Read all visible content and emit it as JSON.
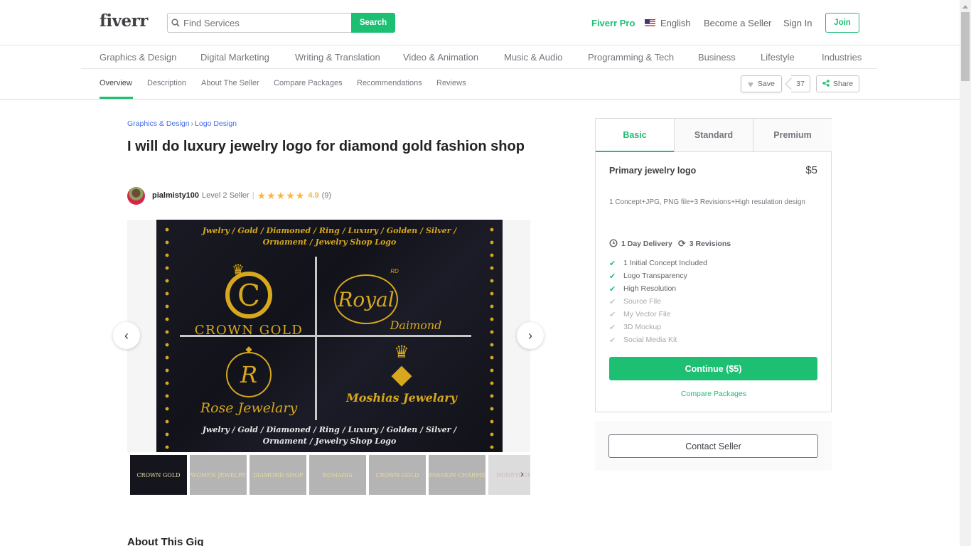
{
  "header": {
    "logo": "fiverr",
    "search": {
      "placeholder": "Find Services",
      "button": "Search"
    },
    "nav": {
      "pro": "Fiverr Pro",
      "language": "English",
      "become_seller": "Become a Seller",
      "sign_in": "Sign In",
      "join": "Join"
    }
  },
  "categories": [
    "Graphics & Design",
    "Digital Marketing",
    "Writing & Translation",
    "Video & Animation",
    "Music & Audio",
    "Programming & Tech",
    "Business",
    "Lifestyle",
    "Industries"
  ],
  "subnav": {
    "tabs": [
      "Overview",
      "Description",
      "About The Seller",
      "Compare Packages",
      "Recommendations",
      "Reviews"
    ],
    "active": "Overview",
    "save_label": "Save",
    "save_count": "37",
    "share_label": "Share"
  },
  "gig": {
    "breadcrumb": [
      "Graphics & Design",
      "Logo Design"
    ],
    "breadcrumb_separator": "›",
    "title": "I will do luxury jewelry logo for diamond gold fashion shop",
    "seller": {
      "username": "pialmisty100",
      "level": "Level 2 Seller",
      "separator": "|",
      "stars": "★★★★★",
      "rating": "4.9",
      "reviews": "(9)"
    },
    "image": {
      "header_line1": "Jwelry / Gold / Diamoned / Ring / Luxury / Golden / Silver /",
      "header_line2": "Ornament / Jewelry Shop Logo",
      "logos": [
        {
          "mark": "C",
          "name": "CROWN GOLD"
        },
        {
          "mark": "Royal",
          "sub": "Daimond",
          "top": "RD"
        },
        {
          "mark": "R",
          "name": "Rose Jewelary"
        },
        {
          "mark": "◆",
          "name": "Moshias Jewelary"
        }
      ],
      "footer_line1": "Jwelry / Gold / Diamoned / Ring / Luxury / Golden / Silver /",
      "footer_line2": "Ornament / Jewelry Shop Logo"
    },
    "thumbnails": [
      "CROWN GOLD",
      "WOMEN JEWELRY",
      "DIAMOND SHOP",
      "ROMADIA",
      "CROWN GOLD",
      "PASSION CHARMS",
      "HONEYCOMB"
    ],
    "about_heading": "About This Gig"
  },
  "package": {
    "tabs": [
      "Basic",
      "Standard",
      "Premium"
    ],
    "active_tab": "Basic",
    "name": "Primary jewelry logo",
    "price": "$5",
    "description": "1 Concept+JPG, PNG file+3 Revisions+High resulation design",
    "delivery": "1 Day Delivery",
    "revisions": "3 Revisions",
    "features": [
      {
        "label": "1 Initial Concept Included",
        "included": true
      },
      {
        "label": "Logo Transparency",
        "included": true
      },
      {
        "label": "High Resolution",
        "included": true
      },
      {
        "label": "Source File",
        "included": false
      },
      {
        "label": "My Vector File",
        "included": false
      },
      {
        "label": "3D Mockup",
        "included": false
      },
      {
        "label": "Social Media Kit",
        "included": false
      }
    ],
    "continue_label": "Continue ($5)",
    "compare_label": "Compare Packages",
    "contact_label": "Contact Seller"
  },
  "icons": {
    "search": "🔍",
    "heart": "♥",
    "share": "share-nodes",
    "prev": "‹",
    "next": "›",
    "clock": "◷",
    "refresh": "⟳",
    "check": "✔"
  },
  "colors": {
    "brand_green": "#1dbf73",
    "link_blue": "#446ee7",
    "star_gold": "#ffb33e",
    "text_dark": "#222325"
  }
}
